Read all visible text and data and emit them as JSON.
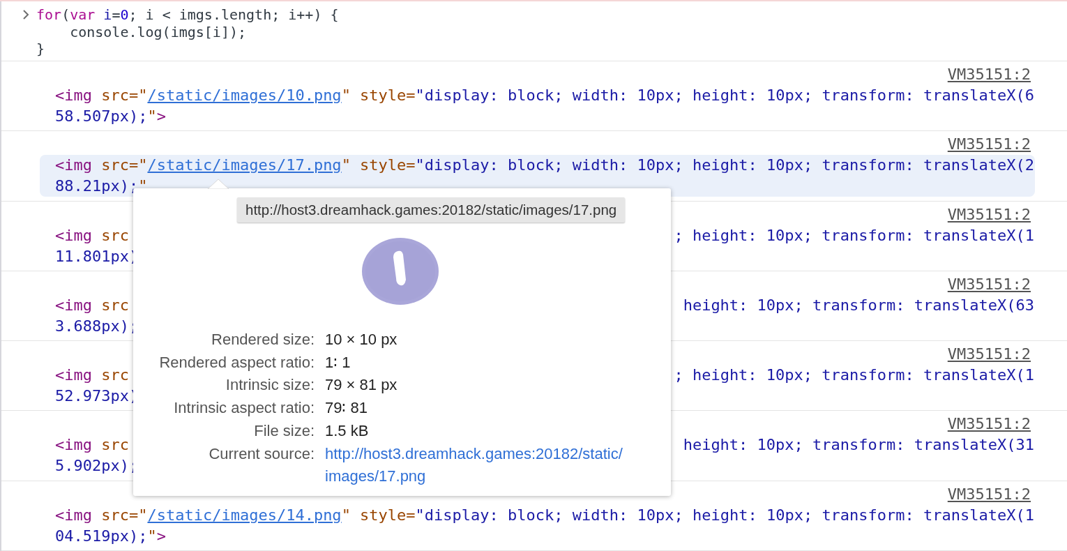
{
  "console_input": {
    "lines": [
      [
        {
          "kind": "keyword",
          "text": "for"
        },
        {
          "kind": "plain",
          "text": "("
        },
        {
          "kind": "keyword",
          "text": "var"
        },
        {
          "kind": "variable",
          "text": " i"
        },
        {
          "kind": "plain",
          "text": "="
        },
        {
          "kind": "number",
          "text": "0"
        },
        {
          "kind": "plain",
          "text": "; i < imgs.length; i++) {"
        }
      ],
      [
        {
          "kind": "plain",
          "text": "    console.log(imgs[i]);"
        }
      ],
      [
        {
          "kind": "plain",
          "text": "}"
        }
      ]
    ]
  },
  "entries": [
    {
      "source": "VM35151:2",
      "selected": false,
      "line_1": [
        {
          "kind": "tag",
          "text": "<img"
        },
        {
          "kind": "attr",
          "text": " src="
        },
        {
          "kind": "attr",
          "text": "\""
        },
        {
          "kind": "link",
          "text": "/static/images/10.png"
        },
        {
          "kind": "attr",
          "text": "\" style="
        },
        {
          "kind": "value",
          "text": "\"display: block; width: 10px; height: 10px; transform: translateX(6"
        }
      ],
      "line_2": [
        {
          "kind": "value",
          "text": "58.507px);"
        },
        {
          "kind": "attr",
          "text": "\""
        },
        {
          "kind": "tag",
          "text": ">"
        }
      ]
    },
    {
      "source": "VM35151:2",
      "selected": true,
      "line_1": [
        {
          "kind": "tag",
          "text": "<img"
        },
        {
          "kind": "attr",
          "text": " src="
        },
        {
          "kind": "attr",
          "text": "\""
        },
        {
          "kind": "link",
          "text": "/static/images/17.png"
        },
        {
          "kind": "attr",
          "text": "\" style="
        },
        {
          "kind": "value",
          "text": "\"display: block; width: 10px; height: 10px; transform: translateX(2"
        }
      ],
      "line_2": [
        {
          "kind": "value",
          "text": "88.21px);"
        },
        {
          "kind": "attr",
          "text": "\""
        }
      ]
    },
    {
      "source": "VM35151:2",
      "selected": false,
      "line_1": [
        {
          "kind": "tag",
          "text": "<img"
        },
        {
          "kind": "attr",
          "text": " src"
        }
      ],
      "line_1_right": [
        {
          "kind": "value",
          "text": "; height: 10px; transform: translateX(1"
        }
      ],
      "line_2": [
        {
          "kind": "value",
          "text": "11.801px)"
        }
      ]
    },
    {
      "source": "VM35151:2",
      "selected": false,
      "line_1": [
        {
          "kind": "tag",
          "text": "<img"
        },
        {
          "kind": "attr",
          "text": " src"
        }
      ],
      "line_1_right": [
        {
          "kind": "value",
          "text": "height: 10px; transform: translateX(63"
        }
      ],
      "line_2": [
        {
          "kind": "value",
          "text": "3.688px);"
        }
      ]
    },
    {
      "source": "VM35151:2",
      "selected": false,
      "line_1": [
        {
          "kind": "tag",
          "text": "<img"
        },
        {
          "kind": "attr",
          "text": " src"
        }
      ],
      "line_1_right": [
        {
          "kind": "value",
          "text": "; height: 10px; transform: translateX(1"
        }
      ],
      "line_2": [
        {
          "kind": "value",
          "text": "52.973px)"
        }
      ]
    },
    {
      "source": "VM35151:2",
      "selected": false,
      "line_1": [
        {
          "kind": "tag",
          "text": "<img"
        },
        {
          "kind": "attr",
          "text": " src"
        }
      ],
      "line_1_right": [
        {
          "kind": "value",
          "text": "height: 10px; transform: translateX(31"
        }
      ],
      "line_2": [
        {
          "kind": "value",
          "text": "5.902px);"
        }
      ]
    },
    {
      "source": "VM35151:2",
      "selected": false,
      "line_1": [
        {
          "kind": "tag",
          "text": "<img"
        },
        {
          "kind": "attr",
          "text": " src="
        },
        {
          "kind": "attr",
          "text": "\""
        },
        {
          "kind": "link",
          "text": "/static/images/14.png"
        },
        {
          "kind": "attr",
          "text": "\" style="
        },
        {
          "kind": "value",
          "text": "\"display: block; width: 10px; height: 10px; transform: translateX(1"
        }
      ],
      "line_2": [
        {
          "kind": "value",
          "text": "04.519px);"
        },
        {
          "kind": "attr",
          "text": "\""
        },
        {
          "kind": "tag",
          "text": ">"
        }
      ]
    }
  ],
  "image_popup": {
    "tooltip": "http://host3.dreamhack.games:20182/static/images/17.png",
    "details": [
      {
        "label": "Rendered size:",
        "value": "10 × 10 px",
        "kind": "text"
      },
      {
        "label": "Rendered aspect ratio:",
        "value": "1∶ 1",
        "kind": "text"
      },
      {
        "label": "Intrinsic size:",
        "value": "79 × 81 px",
        "kind": "text"
      },
      {
        "label": "Intrinsic aspect ratio:",
        "value": "79∶ 81",
        "kind": "text"
      },
      {
        "label": "File size:",
        "value": "1.5 kB",
        "kind": "text"
      },
      {
        "label": "Current source:",
        "value": "http://host3.dreamhack.games:20182/static/images/17.png",
        "kind": "link"
      }
    ]
  }
}
